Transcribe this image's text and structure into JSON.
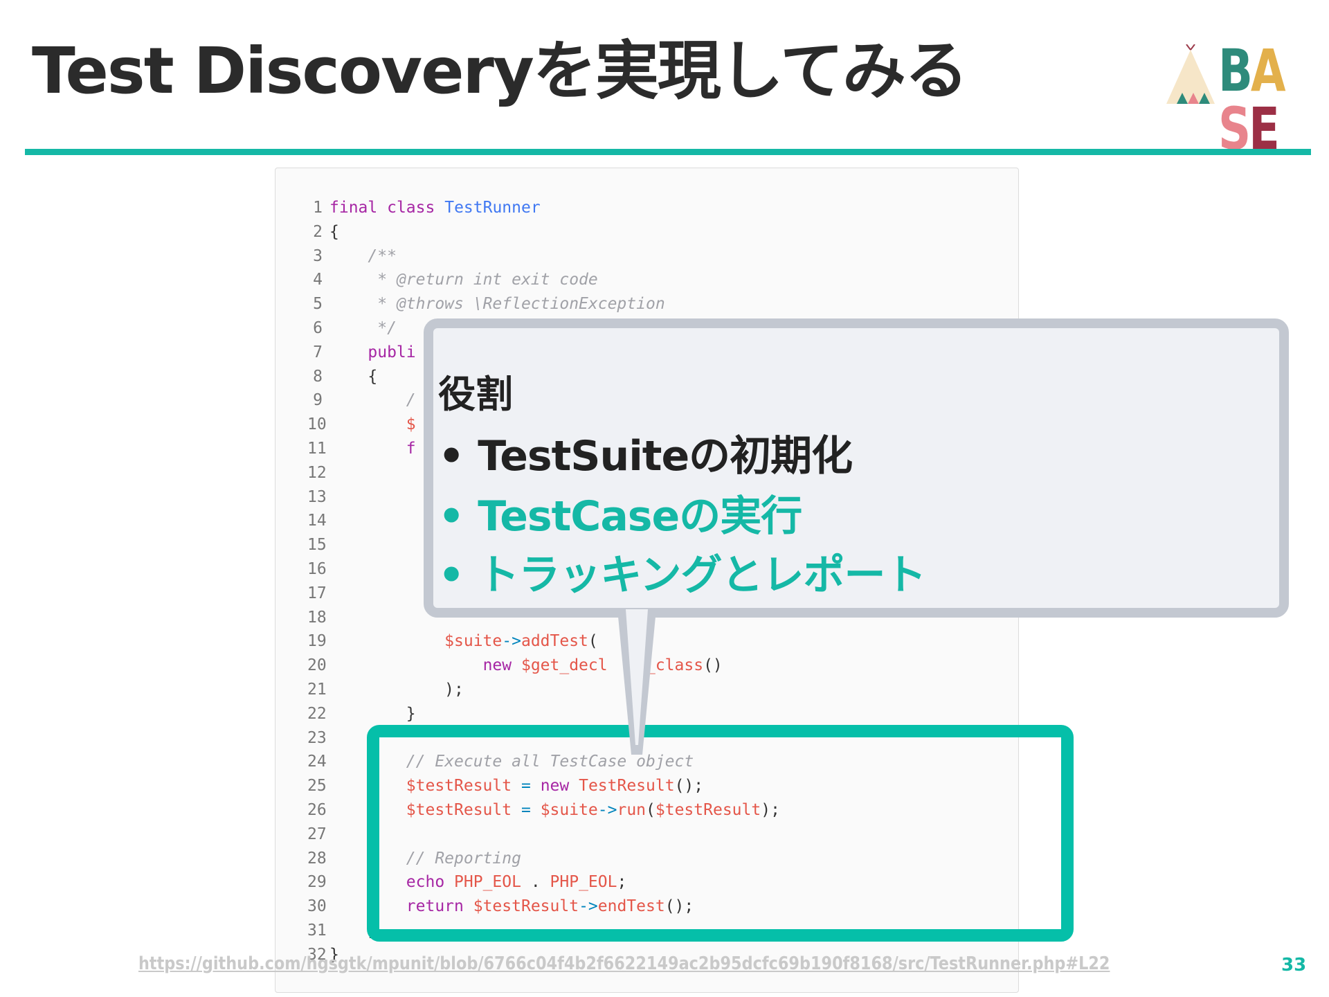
{
  "slide": {
    "title": "Test Discoveryを実現してみる",
    "page_number": "33",
    "source_link": "https://github.com/hgsgtk/mpunit/blob/6766c04f4b2f6622149ac2b95dcfc69b190f8168/src/TestRunner.php#L22"
  },
  "logo": {
    "text_letters": [
      "B",
      "A",
      "S",
      "E"
    ],
    "letter_colors": [
      "#2e8b7b",
      "#e3b04b",
      "#e8848c",
      "#7fcbb8"
    ]
  },
  "colors": {
    "accent": "#15b8a6",
    "highlight_border": "#05bfa9",
    "callout_bg": "#eff1f5",
    "callout_border": "#c3c8d1"
  },
  "code": {
    "line_numbers": [
      "1",
      "2",
      "3",
      "4",
      "5",
      "6",
      "7",
      "8",
      "9",
      "10",
      "11",
      "12",
      "13",
      "14",
      "15",
      "16",
      "17",
      "18",
      "19",
      "20",
      "21",
      "22",
      "23",
      "24",
      "25",
      "26",
      "27",
      "28",
      "29",
      "30",
      "31",
      "32"
    ],
    "tokens": {
      "l1_final": "final",
      "l1_class": "class",
      "l1_name": "TestRunner",
      "l2": "{",
      "l3": "/**",
      "l4": "* @return int exit code",
      "l5": "* @throws \\ReflectionException",
      "l6": "*/",
      "l7": "publi",
      "l8": "{",
      "l9": "/",
      "l10": "$",
      "l11": "f",
      "l19_var": "$suite",
      "l19_arrow": "->",
      "l19_fn": "addTest",
      "l19_paren": "(",
      "l20_new": "new",
      "l20_var": "$get_decl",
      "l20_rest": "ed_class",
      "l20_paren": "()",
      "l21": ");",
      "l22": "}",
      "l24": "// Execute all TestCase object",
      "l25_var": "$testResult",
      "l25_eq": "=",
      "l25_new": "new",
      "l25_cls": "TestResult",
      "l25_end": "();",
      "l26_var": "$testResult",
      "l26_eq": "=",
      "l26_suite": "$suite",
      "l26_arrow": "->",
      "l26_fn": "run",
      "l26_open": "(",
      "l26_arg": "$testResult",
      "l26_end": ");",
      "l28": "// Reporting",
      "l29_echo": "echo",
      "l29_c1": "PHP_EOL",
      "l29_dot": ".",
      "l29_c2": "PHP_EOL",
      "l29_end": ";",
      "l30_return": "return",
      "l30_var": "$testResult",
      "l30_arrow": "->",
      "l30_fn": "endTest",
      "l30_end": "();",
      "l31": "}",
      "l32": "}"
    }
  },
  "callout": {
    "heading": "役割",
    "items": [
      "• TestSuiteの初期化",
      "• TestCaseの実行",
      "• トラッキングとレポート"
    ]
  }
}
